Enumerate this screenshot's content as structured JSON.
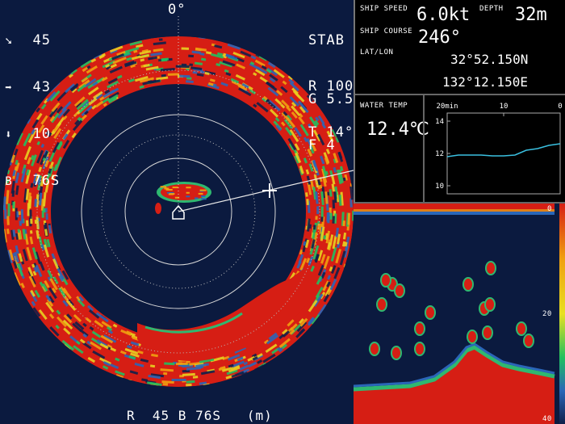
{
  "sonar": {
    "top_left": [
      {
        "icon": "down-right-arrow-icon",
        "glyph": "➘",
        "value": "45"
      },
      {
        "icon": "right-arrow-icon",
        "glyph": "➡",
        "value": "43"
      },
      {
        "icon": "down-arrow-icon",
        "glyph": "⬇",
        "value": "10"
      },
      {
        "icon": "",
        "glyph": "B",
        "value": "76S"
      }
    ],
    "bearing_top": "0°",
    "top_right": [
      "STAB",
      "R 100",
      "T 14°"
    ],
    "right_mid": [
      "G 5.5",
      "F 4"
    ],
    "bottom_status": "R  45 B 76S   (m)"
  },
  "nav": {
    "ship_speed_label": "SHIP SPEED",
    "ship_speed_value": "6.0kt",
    "depth_label": "DEPTH",
    "depth_value": "32m",
    "ship_course_label": "SHIP COURSE",
    "ship_course_value": "246°",
    "latlon_label": "LAT/LON",
    "lat_value": "32°52.150N",
    "lon_value": "132°12.150E"
  },
  "temp": {
    "label": "WATER TEMP",
    "value": "12.4℃",
    "x_labels": [
      "20min",
      "10",
      "0"
    ],
    "y_labels": [
      "14",
      "12",
      "10"
    ]
  },
  "sounder": {
    "scale_labels": [
      "0",
      "20",
      "40"
    ]
  },
  "colors": {
    "sonar_bg": "#0b1a3f",
    "echo_strong": "#e02010",
    "echo_mid": "#f0a010",
    "echo_weak": "#20c060",
    "trace": "#3ac0e0"
  },
  "chart_data": {
    "type": "line",
    "title": "",
    "xlabel": "",
    "ylabel": "",
    "x": [
      20,
      18,
      16,
      14,
      12,
      10,
      8,
      6,
      4,
      2,
      0
    ],
    "series": [
      {
        "values": [
          11.8,
          11.9,
          11.9,
          11.9,
          11.85,
          11.85,
          11.9,
          12.2,
          12.3,
          12.5,
          12.6
        ]
      }
    ],
    "xlim": [
      20,
      0
    ],
    "ylim": [
      9.5,
      14.5
    ]
  }
}
